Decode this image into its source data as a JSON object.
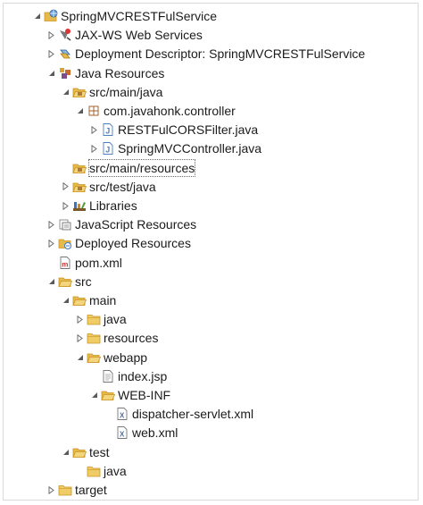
{
  "tree": {
    "items": [
      {
        "label": "SpringMVCRESTFulService",
        "icon": "web-project-icon",
        "expanded": true,
        "twisty": "down"
      },
      {
        "label": "JAX-WS Web Services",
        "icon": "jaxws-services-icon",
        "twisty": "right"
      },
      {
        "label": "Deployment Descriptor: SpringMVCRESTFulService",
        "icon": "deployment-descriptor-icon",
        "twisty": "right"
      },
      {
        "label": "Java Resources",
        "icon": "java-resources-icon",
        "twisty": "down"
      },
      {
        "label": "src/main/java",
        "icon": "source-folder-icon",
        "twisty": "down"
      },
      {
        "label": "com.javahonk.controller",
        "icon": "package-icon",
        "twisty": "down"
      },
      {
        "label": "RESTFulCORSFilter.java",
        "icon": "java-file-icon",
        "twisty": "right"
      },
      {
        "label": "SpringMVCController.java",
        "icon": "java-file-icon",
        "twisty": "right"
      },
      {
        "label": "src/main/resources",
        "icon": "source-folder-icon",
        "twisty": "none",
        "selected": true
      },
      {
        "label": "src/test/java",
        "icon": "source-folder-icon",
        "twisty": "right"
      },
      {
        "label": "Libraries",
        "icon": "libraries-icon",
        "twisty": "right"
      },
      {
        "label": "JavaScript Resources",
        "icon": "javascript-resources-icon",
        "twisty": "right"
      },
      {
        "label": "Deployed Resources",
        "icon": "deployed-resources-icon",
        "twisty": "right"
      },
      {
        "label": "pom.xml",
        "icon": "maven-pom-icon",
        "twisty": "none"
      },
      {
        "label": "src",
        "icon": "folder-icon",
        "twisty": "down"
      },
      {
        "label": "main",
        "icon": "folder-icon",
        "twisty": "down"
      },
      {
        "label": "java",
        "icon": "folder-icon",
        "twisty": "right"
      },
      {
        "label": "resources",
        "icon": "folder-icon",
        "twisty": "right"
      },
      {
        "label": "webapp",
        "icon": "folder-icon",
        "twisty": "down"
      },
      {
        "label": "index.jsp",
        "icon": "jsp-file-icon",
        "twisty": "none"
      },
      {
        "label": "WEB-INF",
        "icon": "folder-icon",
        "twisty": "down"
      },
      {
        "label": "dispatcher-servlet.xml",
        "icon": "xml-file-icon",
        "twisty": "none"
      },
      {
        "label": "web.xml",
        "icon": "xml-file-icon",
        "twisty": "none"
      },
      {
        "label": "test",
        "icon": "folder-icon",
        "twisty": "down"
      },
      {
        "label": "java",
        "icon": "folder-icon",
        "twisty": "none"
      },
      {
        "label": "target",
        "icon": "folder-icon",
        "twisty": "right"
      }
    ]
  },
  "colors": {
    "folder": "#e6b94c",
    "folder_dark": "#c99422",
    "package": "#a0622d",
    "java": "#4e7fc1",
    "twisty": "#6e6e6e"
  }
}
